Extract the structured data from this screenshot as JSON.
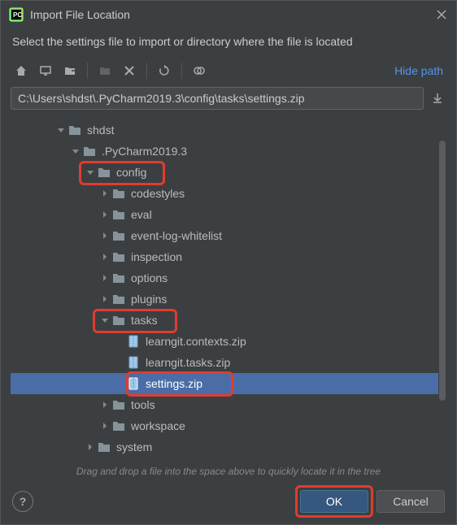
{
  "dialog": {
    "title": "Import File Location",
    "subtitle": "Select the settings file to import or directory where the file is located",
    "hide_path": "Hide path",
    "path": "C:\\Users\\shdst\\.PyCharm2019.3\\config\\tasks\\settings.zip",
    "drag_hint": "Drag and drop a file into the space above to quickly locate it in the tree",
    "ok": "OK",
    "cancel": "Cancel",
    "help": "?"
  },
  "tree": [
    {
      "indent": 3,
      "arrow": "down",
      "icon": "folder",
      "label": "shdst"
    },
    {
      "indent": 4,
      "arrow": "down",
      "icon": "folder",
      "label": ".PyCharm2019.3"
    },
    {
      "indent": 5,
      "arrow": "down",
      "icon": "folder",
      "label": "config",
      "hl": "config"
    },
    {
      "indent": 6,
      "arrow": "right",
      "icon": "folder",
      "label": "codestyles"
    },
    {
      "indent": 6,
      "arrow": "right",
      "icon": "folder",
      "label": "eval"
    },
    {
      "indent": 6,
      "arrow": "right",
      "icon": "folder",
      "label": "event-log-whitelist"
    },
    {
      "indent": 6,
      "arrow": "right",
      "icon": "folder",
      "label": "inspection"
    },
    {
      "indent": 6,
      "arrow": "right",
      "icon": "folder",
      "label": "options"
    },
    {
      "indent": 6,
      "arrow": "right",
      "icon": "folder",
      "label": "plugins"
    },
    {
      "indent": 6,
      "arrow": "down",
      "icon": "folder",
      "label": "tasks",
      "hl": "tasks"
    },
    {
      "indent": 7,
      "arrow": "",
      "icon": "zip",
      "label": "learngit.contexts.zip"
    },
    {
      "indent": 7,
      "arrow": "",
      "icon": "zip",
      "label": "learngit.tasks.zip"
    },
    {
      "indent": 7,
      "arrow": "",
      "icon": "zip",
      "label": "settings.zip",
      "selected": true,
      "hl": "settings"
    },
    {
      "indent": 6,
      "arrow": "right",
      "icon": "folder",
      "label": "tools"
    },
    {
      "indent": 6,
      "arrow": "right",
      "icon": "folder",
      "label": "workspace"
    },
    {
      "indent": 5,
      "arrow": "right",
      "icon": "folder",
      "label": "system"
    }
  ]
}
